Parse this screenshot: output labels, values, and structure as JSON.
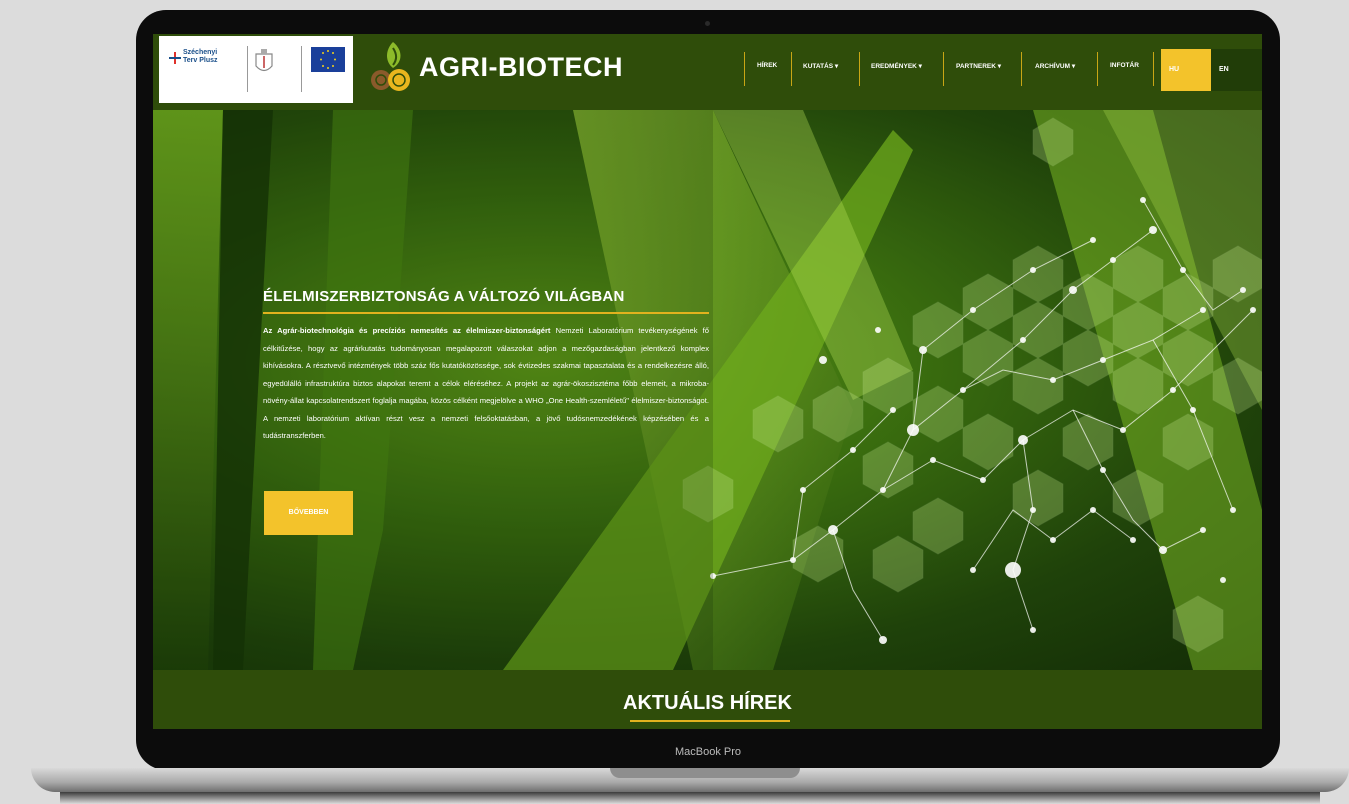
{
  "device": {
    "label": "MacBook Pro"
  },
  "header": {
    "brand": "AGRI-BIOTECH",
    "partner_logos": {
      "szechenyi": "Széchenyi Terv Plusz"
    },
    "nav": [
      {
        "label": "HÍREK"
      },
      {
        "label": "KUTATÁS ▾"
      },
      {
        "label": "EREDMÉNYEK ▾"
      },
      {
        "label": "PARTNEREK ▾"
      },
      {
        "label": "ARCHÍVUM ▾"
      },
      {
        "label": "INFOTÁR"
      }
    ],
    "languages": [
      {
        "label": "HU",
        "active": true
      },
      {
        "label": "EN",
        "active": false
      }
    ]
  },
  "hero": {
    "title": "ÉLELMISZERBIZTONSÁG A VÁLTOZÓ VILÁGBAN",
    "body_bold": "Az Agrár-biotechnológia és precíziós nemesítés az élelmiszer-biztonságért",
    "body_rest": " Nemzeti Laboratórium tevékenységének fő célkitűzése, hogy az agrárkutatás tudományosan megalapozott válaszokat adjon a mezőgazdaságban jelentkező komplex kihívásokra. A résztvevő intézmények több száz fős kutatóközössége, sok évtizedes szakmai tapasztalata és a rendelkezésre álló, egyedülálló infrastruktúra biztos alapokat teremt a célok eléréséhez. A projekt az agrár-ökoszisztéma főbb elemeit, a mikroba-növény-állat kapcsolatrendszert foglalja magába, közös célként megjelölve a WHO „One Health-szemléletű\" élelmiszer-biztonságot. A nemzeti laboratórium aktívan részt vesz a nemzeti felsőoktatásban, a jövő tudósnemzedékének képzésében és a tudástranszferben.",
    "button": "BŐVEBBEN"
  },
  "news": {
    "title": "AKTUÁLIS HÍREK"
  },
  "colors": {
    "primary_green": "#2f4d0a",
    "accent_yellow": "#f3c32b"
  }
}
